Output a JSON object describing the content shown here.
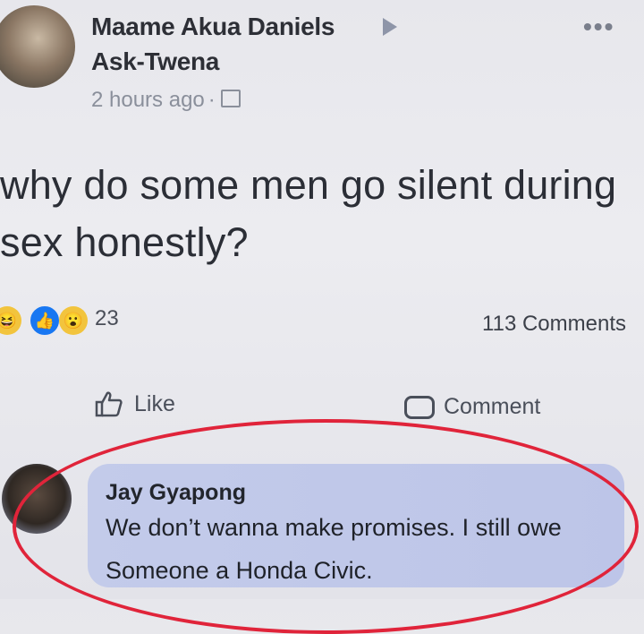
{
  "post": {
    "author": "Maame Akua Daniels",
    "page_name": "Ask-Twena",
    "timestamp": "2 hours ago",
    "separator": "·",
    "text": "why do some men go silent during sex honestly?",
    "reaction_count": "23",
    "comment_count": "113 Comments"
  },
  "actions": {
    "like_label": "Like",
    "comment_label": "Comment"
  },
  "comment": {
    "author": "Jay Gyapong",
    "text": "We don’t wanna make promises. I still owe Someone a Honda Civic."
  },
  "icons": {
    "more": "more-dots-icon",
    "share_arrow": "triangle-right-icon",
    "audience": "globe-icon",
    "reactions": [
      "haha-icon",
      "like-reaction-icon",
      "wow-icon"
    ],
    "like": "thumbs-up-icon",
    "comment": "speech-bubble-icon"
  },
  "colors": {
    "accent_blue": "#1877f2",
    "comment_bubble": "#c3cbea",
    "highlight_circle": "#e0243a"
  }
}
